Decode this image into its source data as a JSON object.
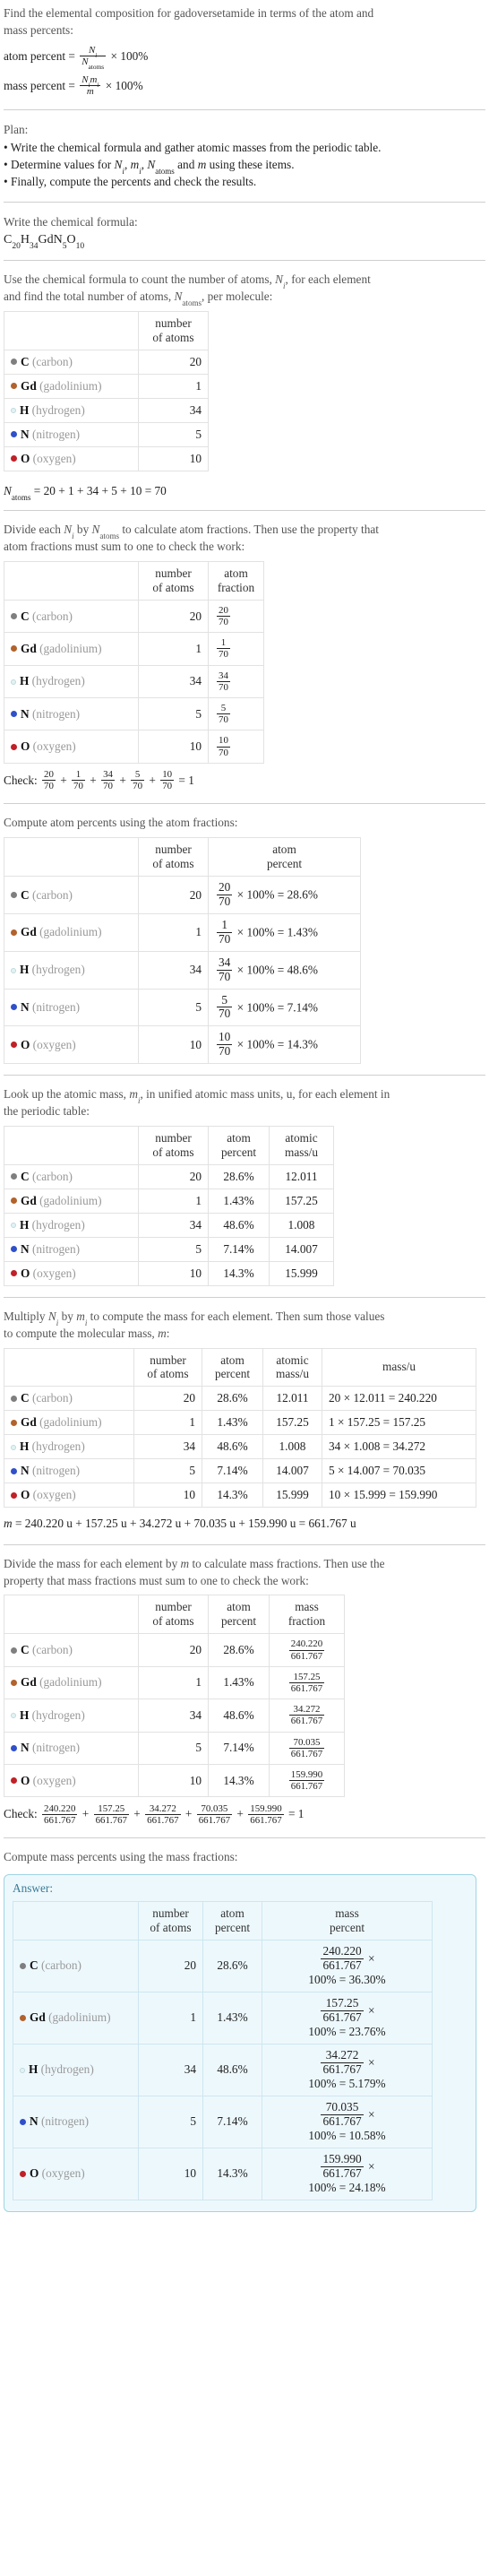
{
  "intro": {
    "line1": "Find the elemental composition for gadoversetamide in terms of the atom and",
    "line2": "mass percents:",
    "atom_percent_label": "atom percent",
    "mass_percent_label": "mass percent",
    "eq": "=",
    "times100": "× 100%",
    "N_i": "N",
    "N_i_sub": "i",
    "N_atoms": "N",
    "N_atoms_sub": "atoms",
    "m_i": "m",
    "m_i_sub": "i",
    "m": "m"
  },
  "plan": {
    "heading": "Plan:",
    "bullets": [
      "Write the chemical formula and gather atomic masses from the periodic table.",
      "Determine values for Nᵢ, mᵢ, Nₐₜₒₘₛ and m using these items.",
      "Finally, compute the percents and check the results."
    ],
    "bullet2_parts": {
      "pre": "Determine values for ",
      "post": " using these items.",
      "mid": " and "
    }
  },
  "formula": {
    "label": "Write the chemical formula:",
    "parts": [
      {
        "sym": "C",
        "sub": "20"
      },
      {
        "sym": "H",
        "sub": "34"
      },
      {
        "sym": "Gd",
        "sub": ""
      },
      {
        "sym": "N",
        "sub": "5"
      },
      {
        "sym": "O",
        "sub": "10"
      }
    ]
  },
  "elements": [
    {
      "symbol": "C",
      "name": "(carbon)",
      "color": "#7f7f7f",
      "filled": true,
      "count": "20",
      "fraction_num": "20",
      "fraction_den": "70",
      "atom_percent": "28.6%",
      "atomic_mass": "12.011",
      "mass_expr": "20 × 12.011 = 240.220",
      "mass_value": "240.220",
      "mass_percent": "36.30%"
    },
    {
      "symbol": "Gd",
      "name": "(gadolinium)",
      "color": "#b2622c",
      "filled": true,
      "count": "1",
      "fraction_num": "1",
      "fraction_den": "70",
      "atom_percent": "1.43%",
      "atomic_mass": "157.25",
      "mass_expr": "1 × 157.25 = 157.25",
      "mass_value": "157.25",
      "mass_percent": "23.76%"
    },
    {
      "symbol": "H",
      "name": "(hydrogen)",
      "color": "#e3f3f5",
      "filled": false,
      "count": "34",
      "fraction_num": "34",
      "fraction_den": "70",
      "atom_percent": "48.6%",
      "atomic_mass": "1.008",
      "mass_expr": "34 × 1.008 = 34.272",
      "mass_value": "34.272",
      "mass_percent": "5.179%"
    },
    {
      "symbol": "N",
      "name": "(nitrogen)",
      "color": "#3050ca",
      "filled": true,
      "count": "5",
      "fraction_num": "5",
      "fraction_den": "70",
      "atom_percent": "7.14%",
      "atomic_mass": "14.007",
      "mass_expr": "5 × 14.007 = 70.035",
      "mass_value": "70.035",
      "mass_percent": "10.58%"
    },
    {
      "symbol": "O",
      "name": "(oxygen)",
      "color": "#c02028",
      "filled": true,
      "count": "10",
      "fraction_num": "10",
      "fraction_den": "70",
      "atom_percent": "14.3%",
      "atomic_mass": "15.999",
      "mass_expr": "10 × 15.999 = 159.990",
      "mass_value": "159.990",
      "mass_percent": "24.18%"
    }
  ],
  "headers": {
    "number_of_atoms_l1": "number",
    "number_of_atoms_l2": "of atoms",
    "atom_fraction_l1": "atom",
    "atom_fraction_l2": "fraction",
    "atom_percent_l1": "atom",
    "atom_percent_l2": "percent",
    "atomic_mass_l1": "atomic",
    "atomic_mass_l2": "mass/u",
    "mass_u": "mass/u",
    "mass_fraction_l1": "mass",
    "mass_fraction_l2": "fraction",
    "mass_percent_l1": "mass",
    "mass_percent_l2": "percent"
  },
  "section_count": {
    "line1_pre": "Use the chemical formula to count the number of atoms, ",
    "line1_post": ", for each element",
    "line2_pre": "and find the total number of atoms, ",
    "line2_post": ", per molecule:",
    "total_eq": "= 20 + 1 + 34 + 5 + 10 = 70"
  },
  "section_fraction": {
    "line1_pre": "Divide each ",
    "line1_mid": " by ",
    "line1_post": " to calculate atom fractions. Then use the property that",
    "line2": "atom fractions must sum to one to check the work:",
    "check_label": "Check:",
    "check_result": "= 1"
  },
  "section_atompct": {
    "heading": "Compute atom percents using the atom fractions:",
    "times": "× 100% =",
    "denominator": "70"
  },
  "section_atomicmass": {
    "line1_pre": "Look up the atomic mass, ",
    "line1_post": ", in unified atomic mass units, u, for each element in",
    "line2": "the periodic table:"
  },
  "section_molmass": {
    "line1_pre": "Multiply ",
    "line1_mid": " by ",
    "line1_post": " to compute the mass for each element. Then sum those values",
    "line2_pre": "to compute the molecular mass, ",
    "line2_post": ":",
    "result": "= 240.220 u + 157.25 u + 34.272 u + 70.035 u + 159.990 u = 661.767 u"
  },
  "section_massfrac": {
    "line1": "Divide the mass for each element by m to calculate mass fractions. Then use the",
    "line2": "property that mass fractions must sum to one to check the work:",
    "line1_pre": "Divide the mass for each element by ",
    "line1_post": " to calculate mass fractions. Then use the",
    "denominator": "661.767",
    "check_label": "Check:",
    "check_result": "= 1"
  },
  "answer": {
    "intro": "Compute mass percents using the mass fractions:",
    "title": "Answer:",
    "denominator": "661.767",
    "times_suffix": "×",
    "pct_prefix": "100% ="
  },
  "colors": {
    "answer_border": "#9fd4e4",
    "answer_bg": "#edf8fd",
    "answer_title": "#3a7b96",
    "rule": "#cfcfcf",
    "cell_border": "#e2e2e2",
    "muted_text": "#999999"
  }
}
